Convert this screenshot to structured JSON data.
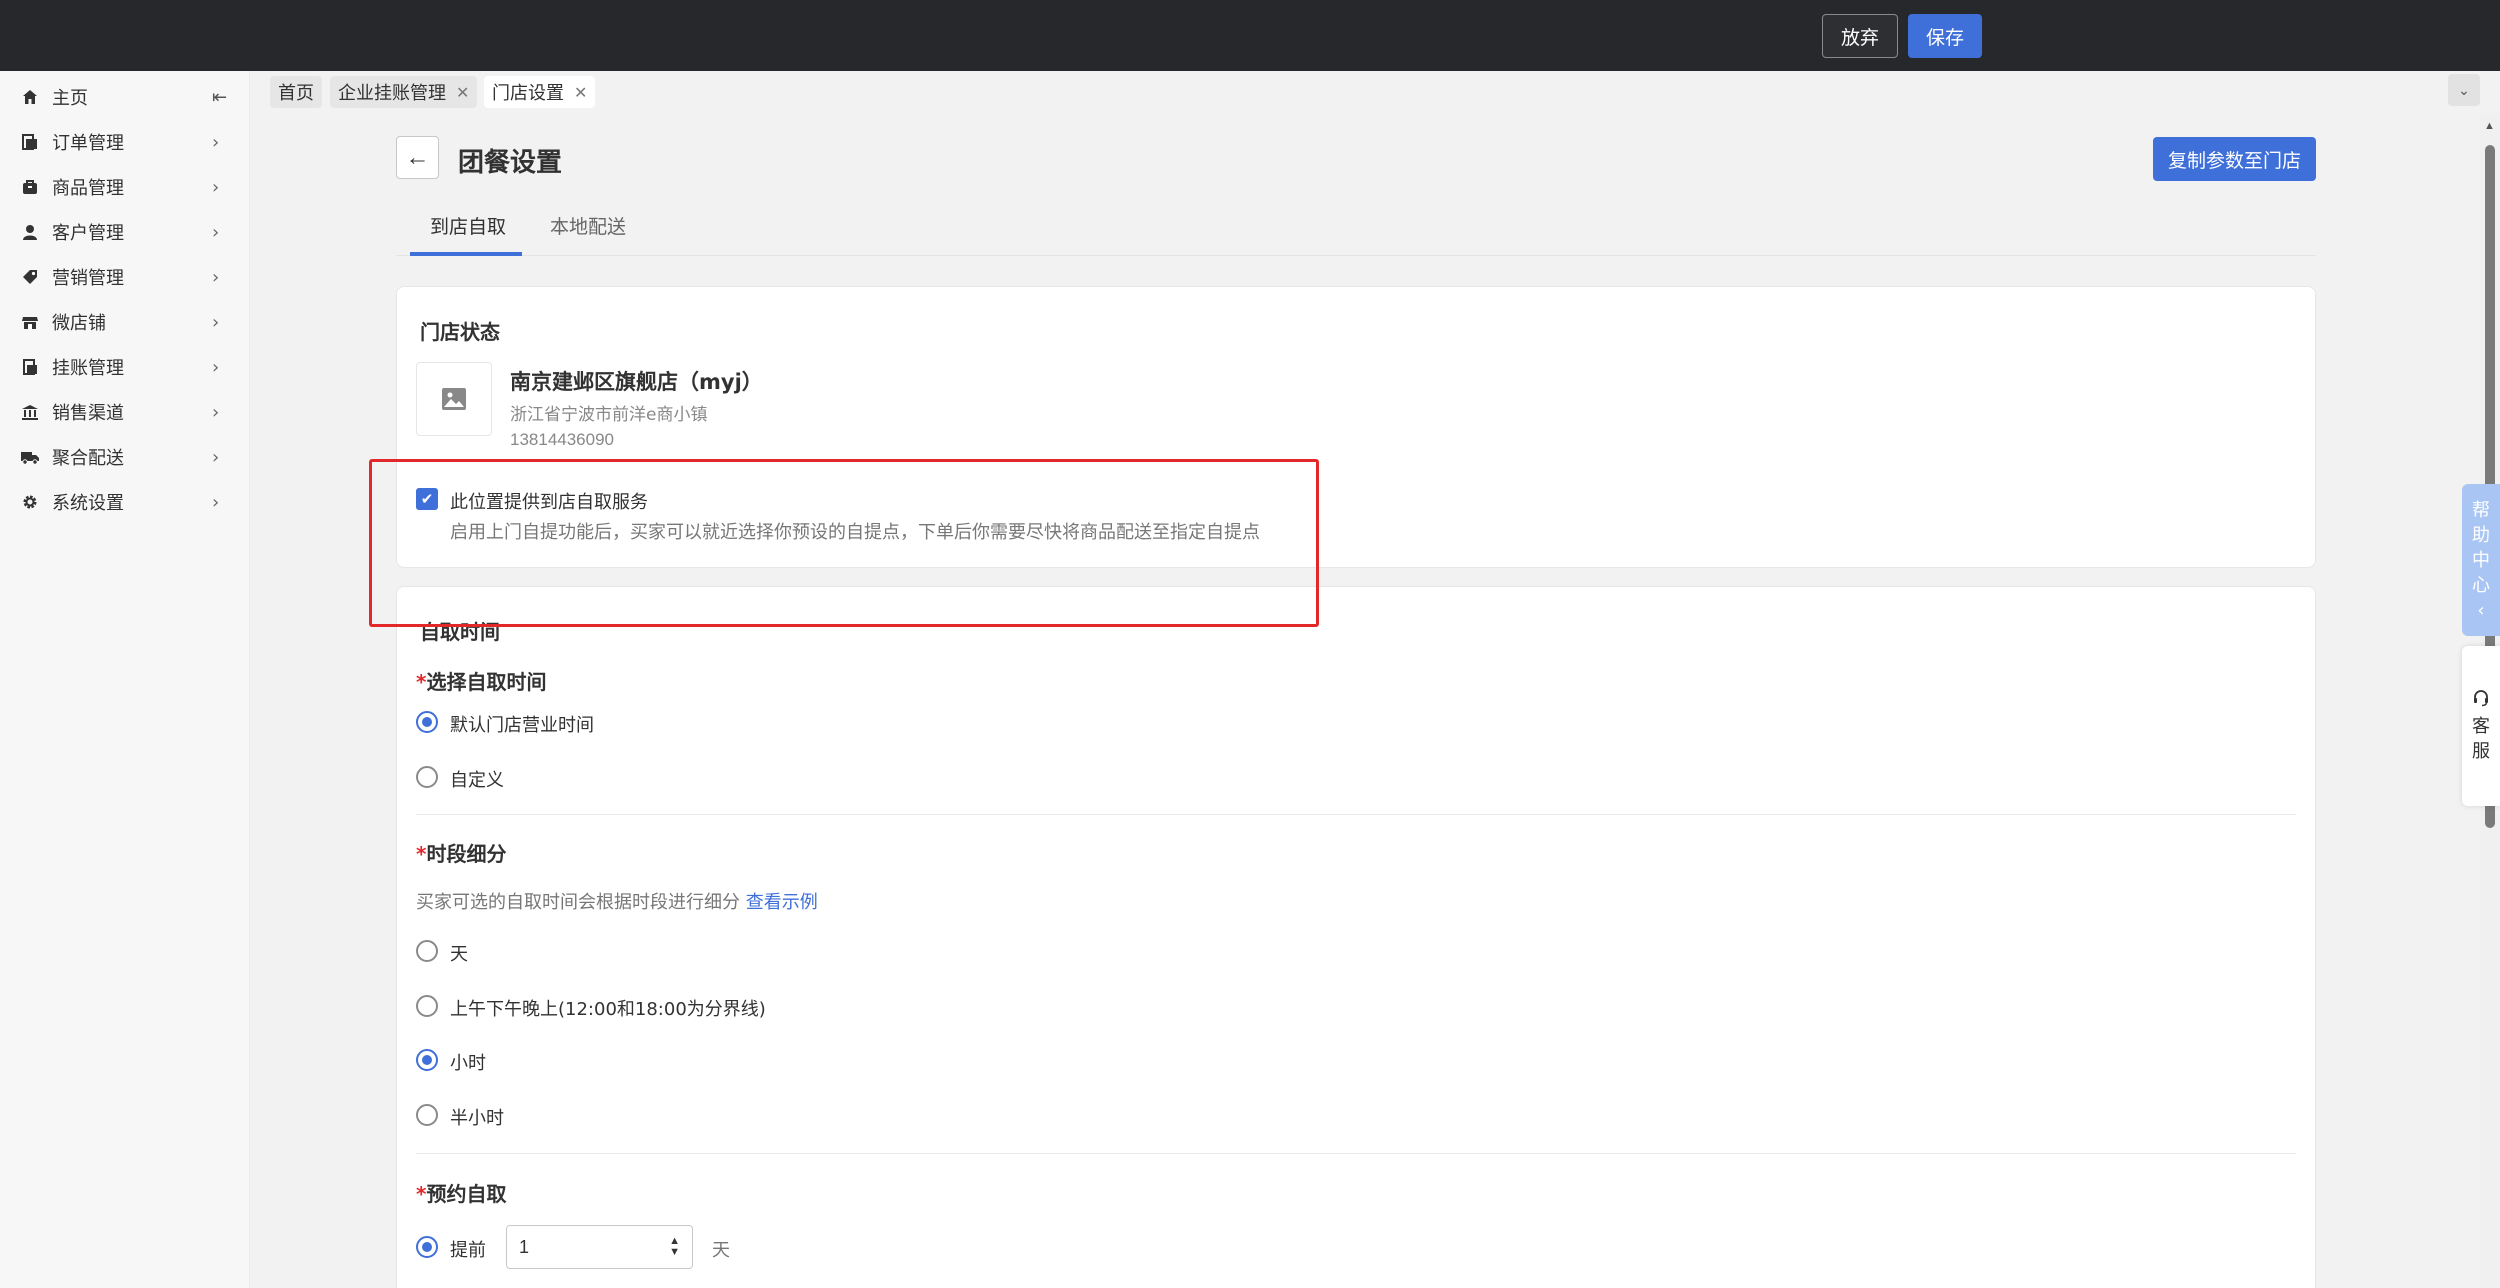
{
  "topbar": {
    "discard_label": "放弃",
    "save_label": "保存"
  },
  "sidebar": {
    "items": [
      {
        "label": "主页",
        "icon": "home-icon"
      },
      {
        "label": "订单管理",
        "icon": "order-icon"
      },
      {
        "label": "商品管理",
        "icon": "goods-icon"
      },
      {
        "label": "客户管理",
        "icon": "user-icon"
      },
      {
        "label": "营销管理",
        "icon": "tag-icon"
      },
      {
        "label": "微店铺",
        "icon": "shop-icon"
      },
      {
        "label": "挂账管理",
        "icon": "ledger-icon"
      },
      {
        "label": "销售渠道",
        "icon": "bank-icon"
      },
      {
        "label": "聚合配送",
        "icon": "truck-icon"
      },
      {
        "label": "系统设置",
        "icon": "gear-icon"
      }
    ]
  },
  "tabs": [
    {
      "label": "首页",
      "closable": false
    },
    {
      "label": "企业挂账管理",
      "closable": true
    },
    {
      "label": "门店设置",
      "closable": true,
      "active": true
    }
  ],
  "page": {
    "title": "团餐设置",
    "copy_button": "复制参数至门店",
    "subtabs": [
      "到店自取",
      "本地配送"
    ],
    "active_subtab": "到店自取"
  },
  "store_status": {
    "section_title": "门店状态",
    "name": "南京建邺区旗舰店（myj）",
    "address": "浙江省宁波市前洋e商小镇",
    "phone": "13814436090",
    "pickup_enabled": true,
    "pickup_label": "此位置提供到店自取服务",
    "pickup_desc": "启用上门自提功能后，买家可以就近选择你预设的自提点，下单后你需要尽快将商品配送至指定自提点"
  },
  "pickup_time": {
    "section_title": "自取时间",
    "select_time": {
      "title": "选择自取时间",
      "options": [
        "默认门店营业时间",
        "自定义"
      ],
      "selected": "默认门店营业时间"
    },
    "segment": {
      "title": "时段细分",
      "hint": "买家可选的自取时间会根据时段进行细分",
      "hint_link": "查看示例",
      "options": [
        "天",
        "上午下午晚上(12:00和18:00为分界线)",
        "小时",
        "半小时"
      ],
      "selected": "小时"
    },
    "reservation": {
      "title": "预约自取",
      "option_label": "提前",
      "value": "1",
      "unit": "天"
    }
  },
  "widgets": {
    "help_chars": [
      "帮",
      "助",
      "中",
      "心",
      "‹"
    ],
    "service_chars": [
      "客",
      "服"
    ]
  },
  "colors": {
    "accent": "#3f6fd8",
    "highlight": "#e3282b",
    "topbar": "#27282b"
  }
}
